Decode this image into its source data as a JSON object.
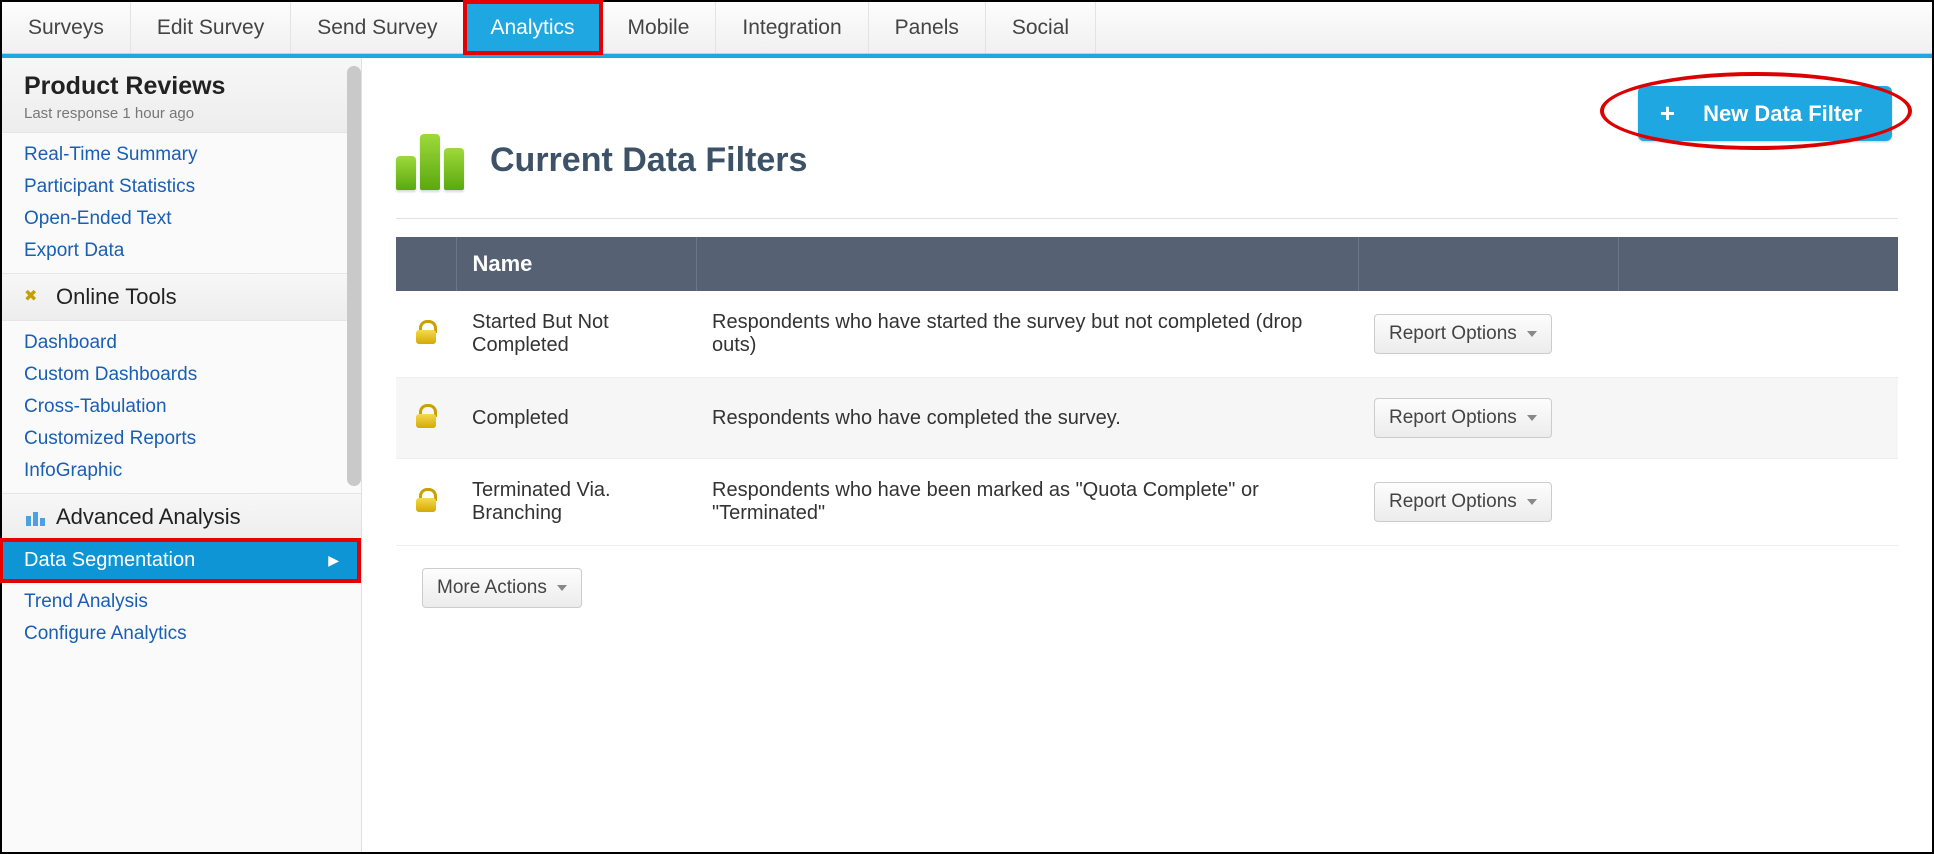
{
  "topnav": {
    "tabs": [
      "Surveys",
      "Edit Survey",
      "Send Survey",
      "Analytics",
      "Mobile",
      "Integration",
      "Panels",
      "Social"
    ],
    "active_index": 3
  },
  "sidebar": {
    "title": "Product Reviews",
    "subtitle": "Last response 1 hour ago",
    "group_reports": [
      "Real-Time Summary",
      "Participant Statistics",
      "Open-Ended Text",
      "Export Data"
    ],
    "section_online_tools": "Online Tools",
    "group_tools": [
      "Dashboard",
      "Custom Dashboards",
      "Cross-Tabulation",
      "Customized Reports",
      "InfoGraphic"
    ],
    "section_advanced": "Advanced Analysis",
    "active_item": "Data Segmentation",
    "group_advanced_rest": [
      "Trend Analysis",
      "Configure Analytics"
    ]
  },
  "main": {
    "new_filter_label": "New Data Filter",
    "title": "Current Data Filters",
    "columns": {
      "name": "Name"
    },
    "report_options_label": "Report Options",
    "more_actions_label": "More Actions",
    "rows": [
      {
        "name": "Started But Not Completed",
        "desc": "Respondents who have started the survey but not completed (drop outs)"
      },
      {
        "name": "Completed",
        "desc": "Respondents who have completed the survey."
      },
      {
        "name": "Terminated Via. Branching",
        "desc": "Respondents who have been marked as \"Quota Complete\" or \"Terminated\""
      }
    ]
  },
  "annotations": {
    "highlight_tab": "Analytics",
    "highlight_sidebar": "Data Segmentation",
    "circle_button": "New Data Filter"
  }
}
